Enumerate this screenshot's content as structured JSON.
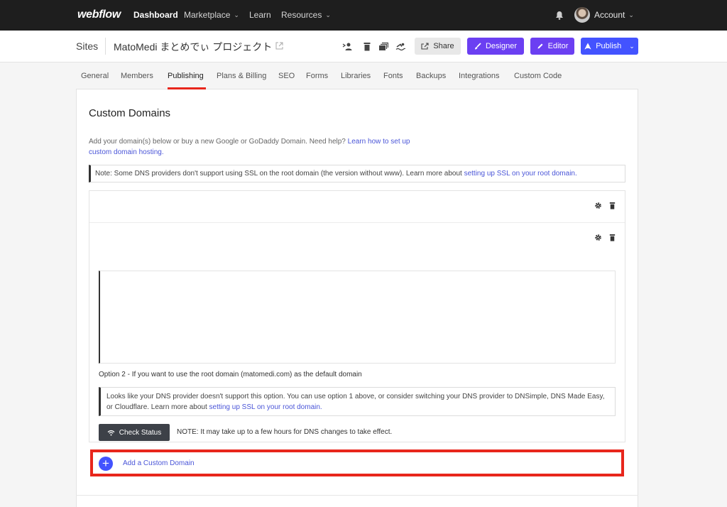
{
  "nav": {
    "logo": "webflow",
    "dashboard": "Dashboard",
    "marketplace": "Marketplace",
    "learn": "Learn",
    "resources": "Resources",
    "account": "Account",
    "icons": [
      "bell-icon",
      "avatar",
      "chevron-down-icon"
    ]
  },
  "header": {
    "sites": "Sites",
    "site_name": "MatoMedi まとめでぃ プロジェクト",
    "share": "Share",
    "designer": "Designer",
    "editor": "Editor",
    "publish": "Publish",
    "tool_icons": [
      "users-icon",
      "trash-icon",
      "stack-icon",
      "swimmer-icon"
    ]
  },
  "tabs": [
    {
      "label": "General"
    },
    {
      "label": "Members"
    },
    {
      "label": "Publishing",
      "active": true
    },
    {
      "label": "Plans & Billing"
    },
    {
      "label": "SEO"
    },
    {
      "label": "Forms"
    },
    {
      "label": "Libraries"
    },
    {
      "label": "Fonts"
    },
    {
      "label": "Backups"
    },
    {
      "label": "Integrations"
    },
    {
      "label": "Custom Code"
    }
  ],
  "custom_domains": {
    "title": "Custom Domains",
    "intro_text": "Add your domain(s) below or buy a new Google or GoDaddy Domain. Need help?",
    "intro_link": "Learn how to set up custom domain hosting.",
    "note_text": "Note: Some DNS providers don't support using SSL on the root domain (the version without www). Learn more about",
    "note_link": "setting up SSL on your root domain.",
    "option2": "Option 2 - If you want to use the root domain (matomedi.com) as the default domain",
    "dns_note_text": "Looks like your DNS provider doesn't support this option. You can use option 1 above, or consider switching your DNS provider to DNSimple, DNS Made Easy, or Cloudflare. Learn more about",
    "dns_note_link": "setting up SSL on your root domain.",
    "check_status": "Check Status",
    "check_note": "NOTE: It may take up to a few hours for DNS changes to take effect.",
    "add_domain": "Add a Custom Domain"
  },
  "colors": {
    "nav_bg": "#1e1e1e",
    "designer": "#6b3ff2",
    "publish": "#4353ff",
    "highlight": "#e8261c",
    "link": "#4a55d8"
  }
}
